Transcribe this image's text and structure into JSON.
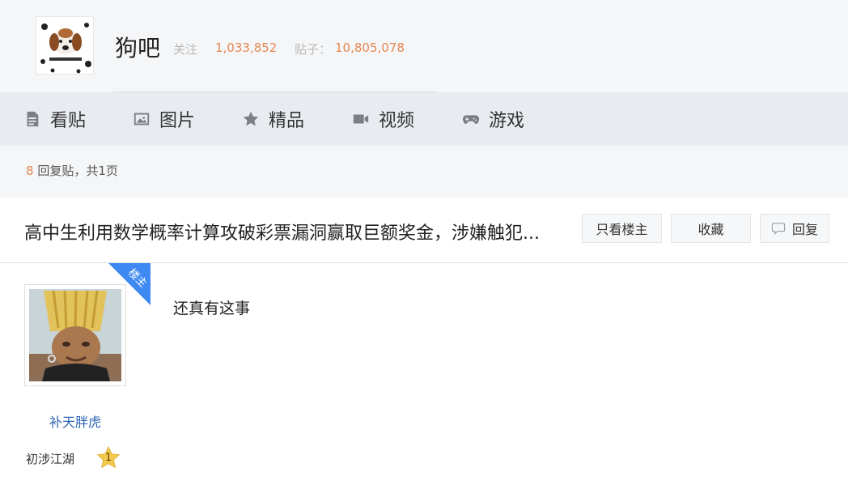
{
  "forum": {
    "name": "狗吧",
    "follow_label": "关注",
    "follow_count": "1,033,852",
    "posts_label": "贴子：",
    "posts_count": "10,805,078"
  },
  "nav": {
    "items": [
      {
        "label": "看贴",
        "icon": "document-icon"
      },
      {
        "label": "图片",
        "icon": "image-icon"
      },
      {
        "label": "精品",
        "icon": "star-icon"
      },
      {
        "label": "视频",
        "icon": "video-icon"
      },
      {
        "label": "游戏",
        "icon": "gamepad-icon"
      }
    ]
  },
  "thread": {
    "reply_count": "8",
    "reply_suffix": "回复贴，共1页",
    "title": "高中生利用数学概率计算攻破彩票漏洞赢取巨额奖金，涉嫌触犯...",
    "buttons": {
      "only_op": "只看楼主",
      "favorite": "收藏",
      "reply": "回复"
    }
  },
  "post": {
    "author_badge": "楼主",
    "username": "补天胖虎",
    "level_title": "初涉江湖",
    "level_number": "1",
    "content": "还真有这事"
  },
  "colors": {
    "accent_orange": "#e4864f",
    "link_blue": "#2d64b3",
    "badge_blue": "#3e8af2",
    "level_star": "#f2c94c"
  }
}
